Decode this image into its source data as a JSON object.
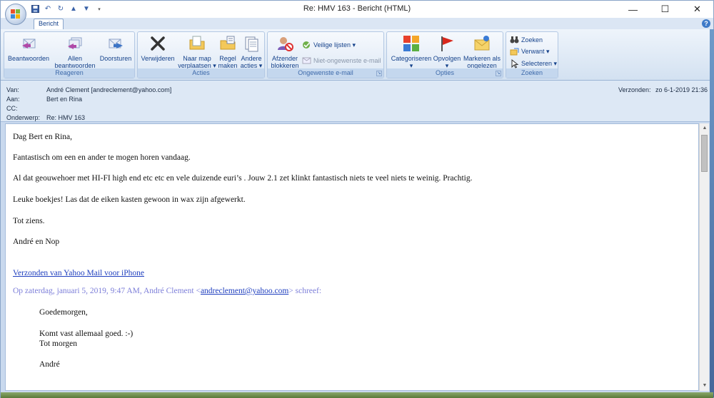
{
  "window": {
    "title": "Re: HMV 163 - Bericht (HTML)",
    "minimize": "—",
    "maximize": "☐",
    "close": "✕"
  },
  "tabs": {
    "active": "Bericht",
    "help": "?"
  },
  "ribbon": {
    "reageren": {
      "label": "Reageren",
      "reply": "Beantwoorden",
      "reply_all_1": "Allen",
      "reply_all_2": "beantwoorden",
      "forward": "Doorsturen"
    },
    "acties": {
      "label": "Acties",
      "delete": "Verwijderen",
      "move_1": "Naar map",
      "move_2": "verplaatsen ▾",
      "rule_1": "Regel",
      "rule_2": "maken",
      "other_1": "Andere",
      "other_2": "acties ▾"
    },
    "ongewenst": {
      "label": "Ongewenste e-mail",
      "block_1": "Afzender",
      "block_2": "blokkeren",
      "safe": "Veilige lijsten ▾",
      "notjunk": "Niet-ongewenste e-mail"
    },
    "opties": {
      "label": "Opties",
      "categorize": "Categoriseren",
      "categorize_arrow": "▾",
      "followup": "Opvolgen",
      "followup_arrow": "▾",
      "markread_1": "Markeren als",
      "markread_2": "ongelezen"
    },
    "zoeken": {
      "label": "Zoeken",
      "find": "Zoeken",
      "related": "Verwant ▾",
      "select": "Selecteren ▾"
    }
  },
  "header": {
    "from_label": "Van:",
    "from": "André Clement [andreclement@yahoo.com]",
    "to_label": "Aan:",
    "to": "Bert en Rina",
    "cc_label": "CC:",
    "cc": "",
    "subject_label": "Onderwerp:",
    "subject": "Re: HMV 163",
    "sent_label": "Verzonden:",
    "sent": "zo 6-1-2019 21:36"
  },
  "body": {
    "greeting": "Dag Bert en Rina,",
    "p1": "Fantastisch om een en ander te mogen horen vandaag.",
    "p2": "Al dat geouwehoer met HI-FI high end etc etc en vele duizende euri’s . Jouw 2.1 zet klinkt fantastisch niets te veel niets te weinig. Prachtig.",
    "p3": "Leuke boekjes! Las dat de eiken kasten gewoon in wax zijn afgewerkt.",
    "p4": "Tot ziens.",
    "signature": "André en Nop",
    "yahoo_link": "Verzonden van Yahoo Mail voor iPhone",
    "quote_prefix": "Op zaterdag, januari 5, 2019, 9:47 AM, André Clement <",
    "quote_email": "andreclement@yahoo.com",
    "quote_suffix": "> schreef:",
    "q1": "Goedemorgen,",
    "q2": "Komt vast allemaal goed. :-)",
    "q3": "Tot morgen",
    "q4": "André"
  },
  "colors": {
    "ribbon_bg": "#dde8f5",
    "group_label": "#c4d7ee",
    "link": "#1f3fbf",
    "quote": "#7d7fd9"
  }
}
